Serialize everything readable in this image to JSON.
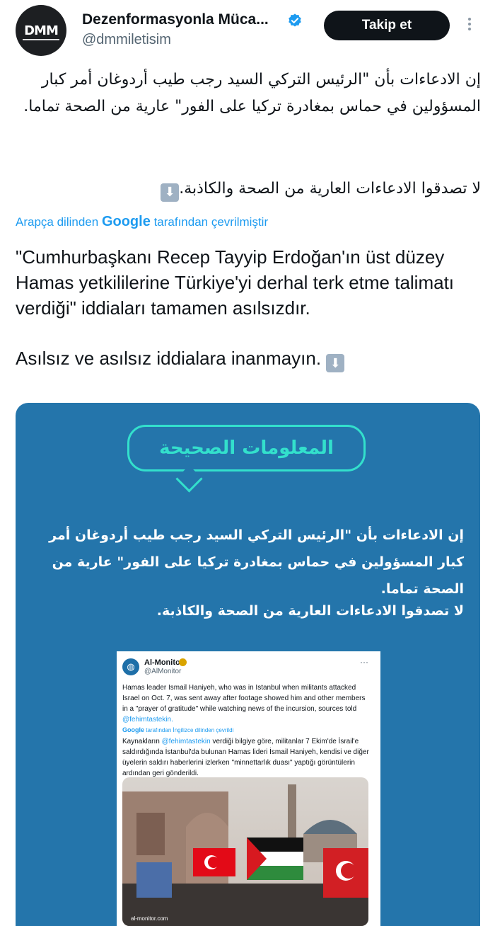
{
  "account": {
    "display_name": "Dezenformasyonla Müca...",
    "handle": "@dmmiletisim",
    "avatar_text": "DMM",
    "follow_label": "Takip et"
  },
  "tweet": {
    "arabic_p1": "إن الادعاءات بأن \"الرئيس التركي السيد رجب طيب أردوغان أمر كبار المسؤولين في حماس بمغادرة تركيا على الفور\" عارية من الصحة تماما.",
    "arabic_p2": "لا تصدقوا الادعاءات العارية من الصحة والكاذبة.",
    "translated_prefix": "Arapça dilinden",
    "translated_brand": "Google",
    "translated_suffix": "tarafından çevrilmiştir",
    "turkish_p1": "\"Cumhurbaşkanı Recep Tayyip Erdoğan'ın üst düzey Hamas yetkililerine Türkiye'yi derhal terk etme talimatı verdiği\" iddiaları tamamen asılsızdır.",
    "turkish_p2": "Asılsız ve asılsız iddialara inanmayın."
  },
  "media": {
    "bubble_title": "المعلومات الصحيحة",
    "card_text_1": "إن الادعاءات بأن \"الرئيس التركي السيد رجب طيب أردوغان أمر كبار المسؤولين في حماس بمغادرة تركيا على الفور\" عارية من الصحة تماما.",
    "card_text_2": "لا تصدقوا الادعاءات العارية من الصحة والكاذبة.",
    "embed": {
      "name": "Al-Monitor",
      "handle": "@AlMonitor",
      "text_en_a": "Hamas leader Ismail Haniyeh, who was in Istanbul when militants attacked Israel on Oct. 7, was sent away after footage showed him and other members in a \"prayer of gratitude\" while watching news of the incursion, sources told ",
      "text_en_link": "@fehimtastekin.",
      "translated_brand": "Google",
      "translated_note": "tarafından İngilizce dilinden çevrildi",
      "text_tr_a": "Kaynakların ",
      "text_tr_link": "@fehimtastekin",
      "text_tr_b": " verdiği bilgiye göre, militanlar 7 Ekim'de İsrail'e saldırdığında İstanbul'da bulunan Hamas lideri İsmail Haniyeh, kendisi ve diğer üyelerin saldırı haberlerini izlerken \"minnettarlık duası\" yaptığı görüntülerin ardından geri gönderildi.",
      "photo_caption": "al-monitor.com"
    }
  }
}
